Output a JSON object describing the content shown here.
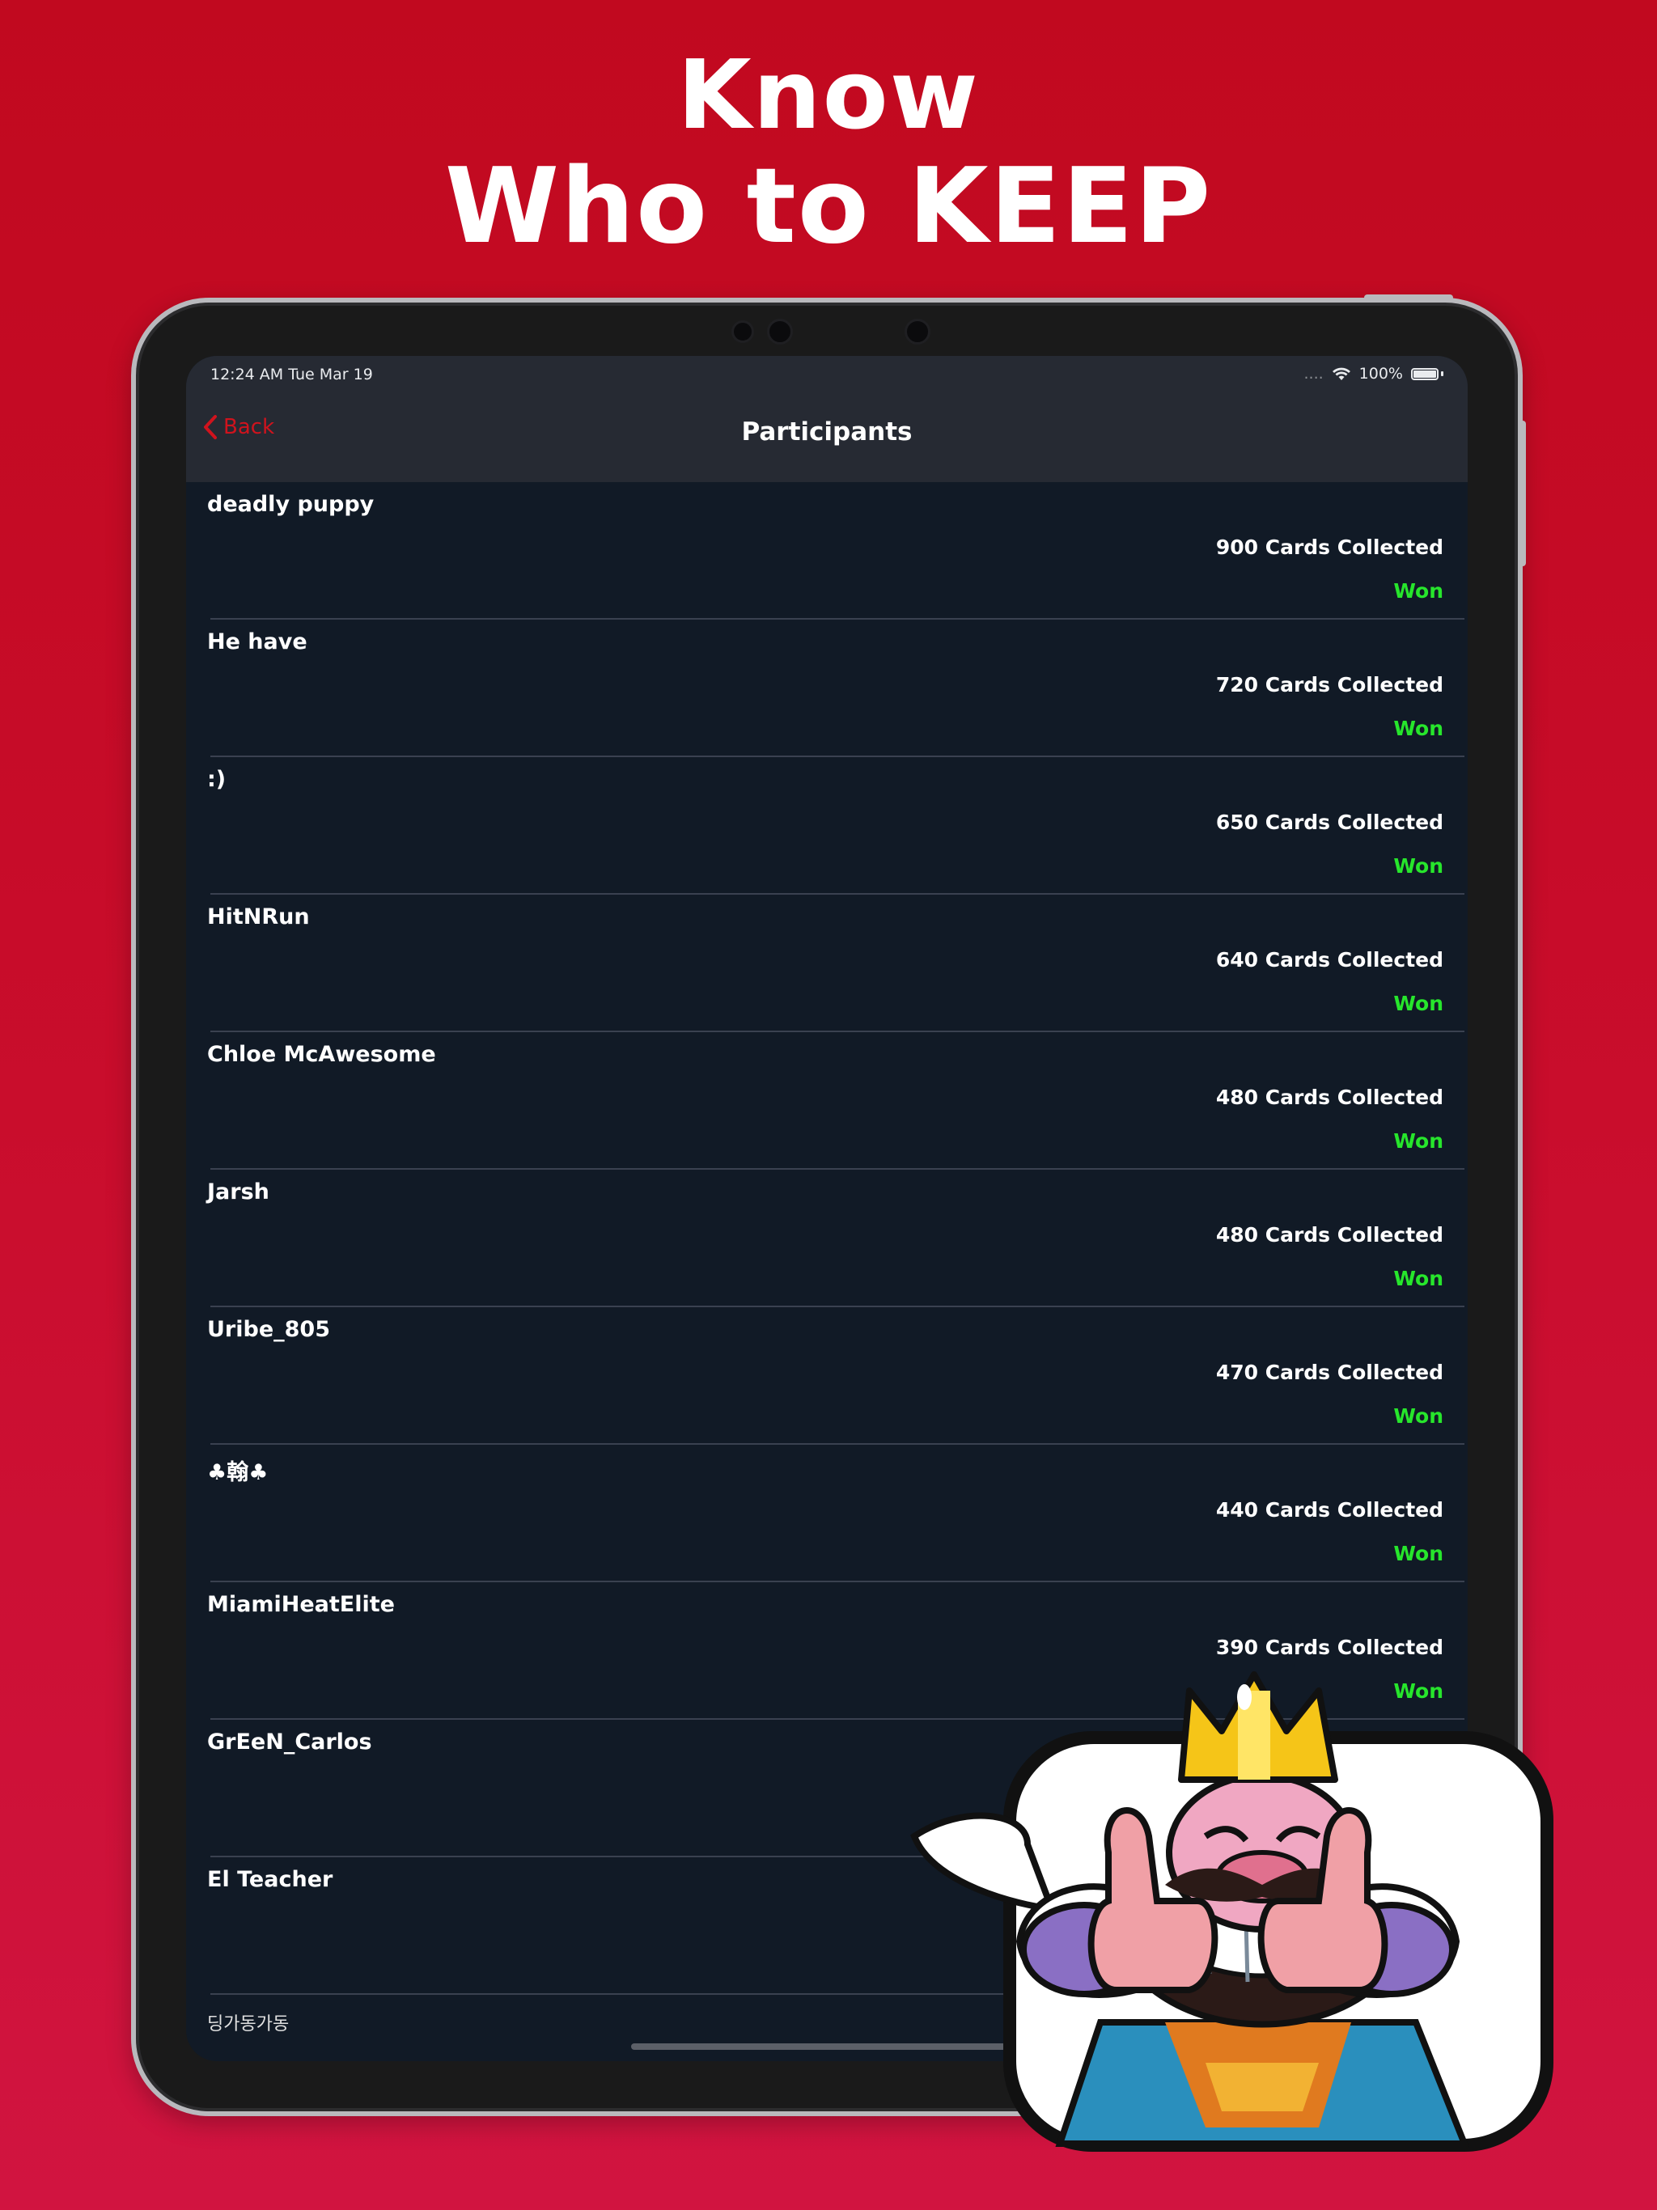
{
  "headline": {
    "line1": "Know",
    "line2": "Who to KEEP"
  },
  "status_bar": {
    "time": "12:24 AM   Tue Mar 19",
    "signal": "....",
    "battery": "100%"
  },
  "nav": {
    "back_label": "Back",
    "title": "Participants"
  },
  "participants": [
    {
      "name": "deadly puppy",
      "cards": "900 Cards Collected",
      "status": "Won"
    },
    {
      "name": "He have",
      "cards": "720 Cards Collected",
      "status": "Won"
    },
    {
      "name": ":)",
      "cards": "650 Cards Collected",
      "status": "Won"
    },
    {
      "name": "HitNRun",
      "cards": "640 Cards Collected",
      "status": "Won"
    },
    {
      "name": "Chloe McAwesome",
      "cards": "480 Cards Collected",
      "status": "Won"
    },
    {
      "name": "Jarsh",
      "cards": "480 Cards Collected",
      "status": "Won"
    },
    {
      "name": "Uribe_805",
      "cards": "470 Cards Collected",
      "status": "Won"
    },
    {
      "name": "♣翰♣",
      "cards": "440 Cards Collected",
      "status": "Won"
    },
    {
      "name": "MiamiHeatElite",
      "cards": "390 Cards Collected",
      "status": "Won"
    },
    {
      "name": "GrEeN_Carlos",
      "cards": "",
      "status": ""
    },
    {
      "name": "El Teacher",
      "cards": "",
      "status": ""
    },
    {
      "name": "딩가동가동",
      "cards": "",
      "status": ""
    }
  ],
  "colors": {
    "background": "#c90d2c",
    "accent": "#d0131d",
    "won": "#27e62c",
    "list_bg": "#111a26",
    "nav_bg": "#262a33"
  },
  "icons": {
    "back": "chevron-left-icon",
    "wifi": "wifi-icon",
    "battery": "battery-icon",
    "mascot": "king-thumbs-up-mascot"
  }
}
